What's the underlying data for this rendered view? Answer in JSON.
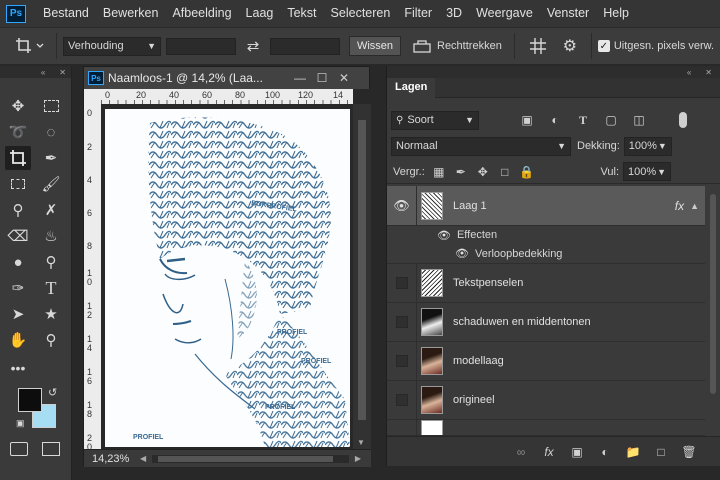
{
  "app": {
    "logo": "Ps"
  },
  "menu": [
    "Bestand",
    "Bewerken",
    "Afbeelding",
    "Laag",
    "Tekst",
    "Selecteren",
    "Filter",
    "3D",
    "Weergave",
    "Venster",
    "Help"
  ],
  "options": {
    "ratio_select": "Verhouding",
    "clear_button": "Wissen",
    "straighten_label": "Rechttrekken",
    "delete_pixels_label": "Uitgesn. pixels verw."
  },
  "document": {
    "title": "Naamloos-1 @ 14,2% (Laa...",
    "zoom": "14,23%",
    "ruler_top": [
      "0",
      "20",
      "40",
      "60",
      "80",
      "100",
      "120",
      "14"
    ],
    "ruler_left": [
      "0",
      "2",
      "4",
      "6",
      "8",
      "1 0",
      "1 2",
      "1 4",
      "1 6",
      "1 8",
      "2 0"
    ],
    "text_art_words": [
      "PROFIEL",
      "BOKPROFIEL",
      "PROFIEL",
      "PROFIEL",
      "PROFIEL"
    ]
  },
  "layers": {
    "tab": "Lagen",
    "filter_label": "Soort",
    "blend_mode": "Normaal",
    "opacity_label": "Dekking:",
    "opacity": "100%",
    "lock_label": "Vergr.:",
    "fill_label": "Vul:",
    "fill": "100%",
    "items": [
      {
        "name": "Laag 1",
        "fx": "fx",
        "visible": true,
        "selected": true
      },
      {
        "name": "Tekstpenselen",
        "visible": false
      },
      {
        "name": "schaduwen en middentonen",
        "visible": false
      },
      {
        "name": "modellaag",
        "visible": false
      },
      {
        "name": "origineel",
        "visible": false
      }
    ],
    "effects_label": "Effecten",
    "effect_item": "Verloopbedekking"
  },
  "colors": {
    "accent": "#31a8ff",
    "foreground": "#0d0d0d",
    "background": "#a6ddf3",
    "ink": "#2f5f86"
  }
}
